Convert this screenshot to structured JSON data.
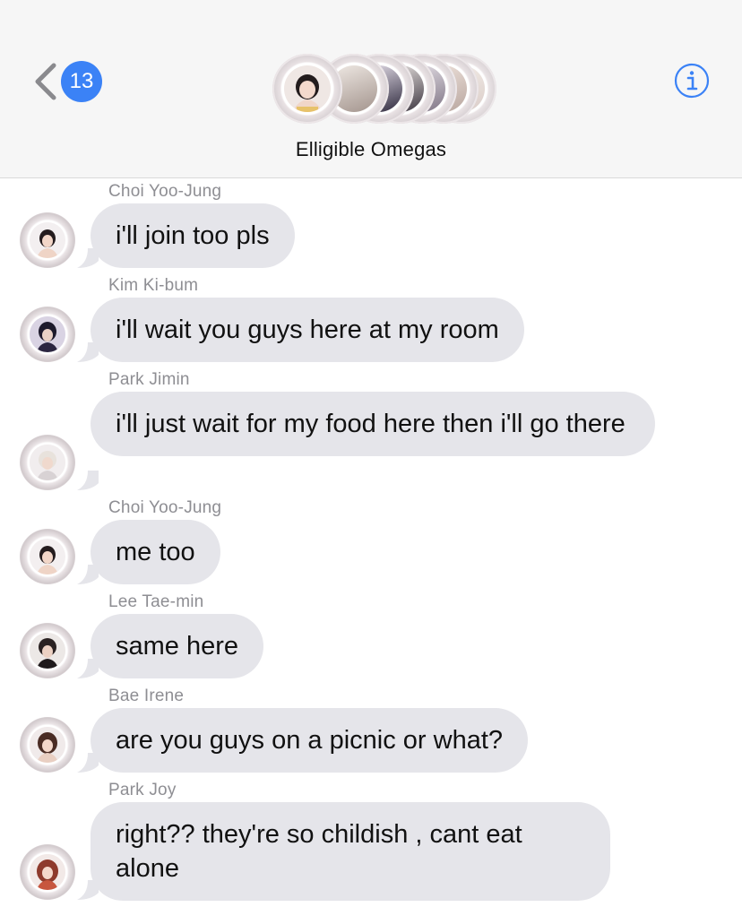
{
  "header": {
    "back_badge_count": "13",
    "group_name": "Elligible Omegas",
    "accent_color": "#3b82f6",
    "icons": {
      "back": "chevron-left-icon",
      "info": "info-icon"
    }
  },
  "messages": [
    {
      "sender": "Choi Yoo-Jung",
      "text": "i'll join too pls"
    },
    {
      "sender": "Kim Ki-bum",
      "text": "i'll wait you guys here at my room"
    },
    {
      "sender": "Park Jimin",
      "text": "i'll just wait for my food here then i'll go there"
    },
    {
      "sender": "Choi Yoo-Jung",
      "text": "me too"
    },
    {
      "sender": "Lee Tae-min",
      "text": "same here"
    },
    {
      "sender": "Bae Irene",
      "text": "are you guys on a picnic or what?"
    },
    {
      "sender": "Park Joy",
      "text": "right?? they're so childish , cant eat alone"
    }
  ],
  "colors": {
    "bubble_incoming": "#e5e5ea",
    "sender_name": "#8e8e93",
    "header_bg": "#f6f6f6"
  }
}
